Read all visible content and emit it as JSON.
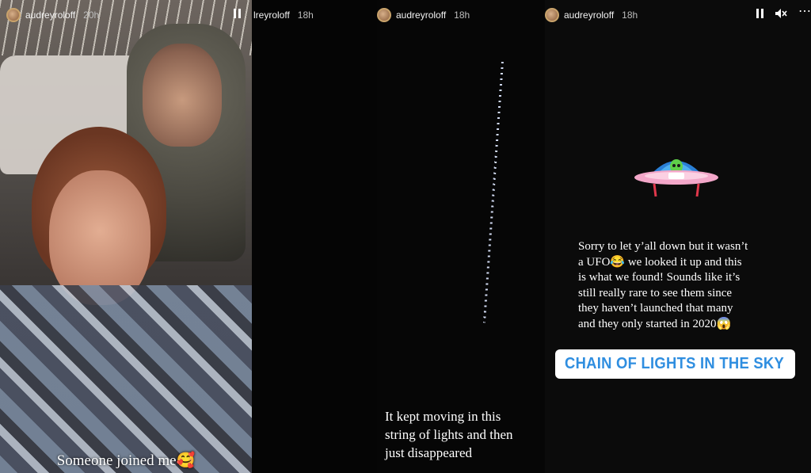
{
  "panels": [
    {
      "username": "audreyroloff",
      "time": "20h",
      "caption": "Someone joined me🥰"
    },
    {
      "username": "lreyroloff",
      "time": "18h"
    },
    {
      "username": "audreyroloff",
      "time": "18h",
      "caption_lines": [
        "It kept moving in this",
        "string of lights and then",
        "just disappeared"
      ]
    },
    {
      "username": "audreyroloff",
      "time": "18h",
      "text_lines": [
        "Sorry to let y’all down but it wasn’t",
        "a UFO😂 we looked it up and this",
        "is what we found! Sounds like it’s",
        "still really rare to see them since",
        "they haven’t launched that many",
        "and they only started in 2020😱"
      ],
      "link_label": "CHAIN OF LIGHTS IN THE SKY"
    }
  ],
  "icons": {
    "pause": "pause-icon",
    "mute": "mute-icon",
    "more": "more-icon",
    "link": "link-icon",
    "ufo": "ufo-sticker"
  },
  "colors": {
    "link_blue": "#2f8ee0",
    "ufo_pink": "#f3a7c9",
    "ufo_dome": "#2a7fd6",
    "alien_green": "#5fd04a"
  }
}
